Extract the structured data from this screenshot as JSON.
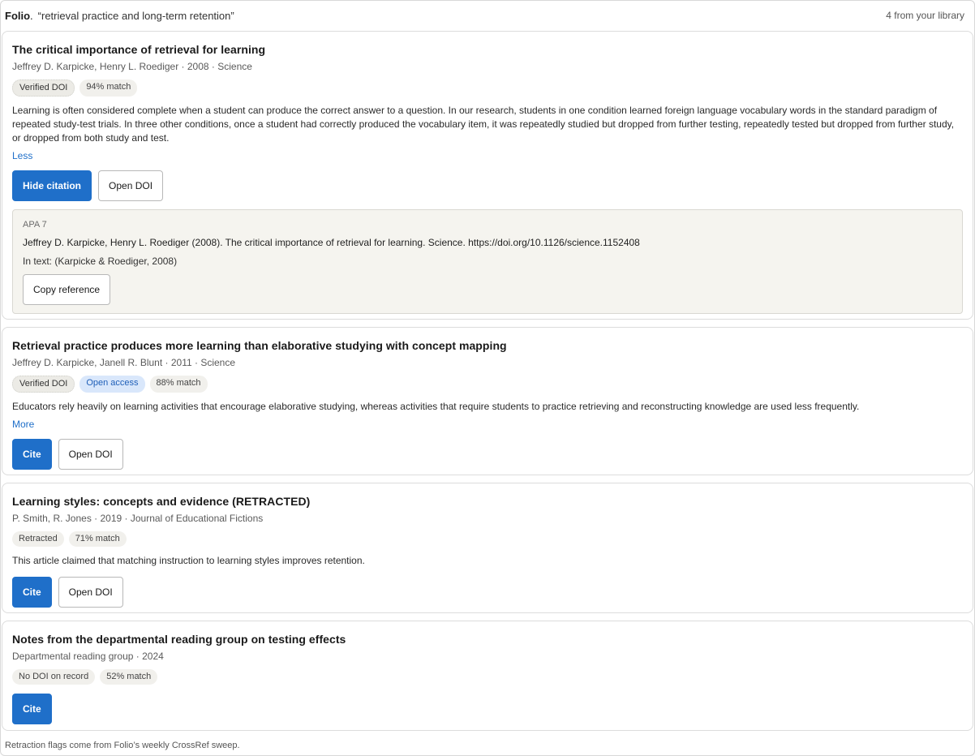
{
  "header": {
    "brand": "Folio",
    "query": "“retrieval practice and long-term retention”",
    "count": "4 from your library"
  },
  "results": [
    {
      "title": "The critical importance of retrieval for learning",
      "meta": "Jeffrey D. Karpicke, Henry L. Roediger · 2008 · Science",
      "badges": [
        "Verified DOI",
        "94% match"
      ],
      "abstract": "Learning is often considered complete when a student can produce the correct answer to a question. In our research, students in one condition learned foreign language vocabulary words in the standard paradigm of repeated study-test trials. In three other conditions, once a student had correctly produced the vocabulary item, it was repeatedly studied but dropped from further testing, repeatedly tested but dropped from further study, or dropped from both study and test.",
      "toggle": "Less",
      "primary_button": "Hide citation",
      "secondary_button": "Open DOI",
      "citation": {
        "style": "APA 7",
        "reference": "Jeffrey D. Karpicke, Henry L. Roediger (2008). The critical importance of retrieval for learning. Science. https://doi.org/10.1126/science.1152408",
        "in_text": "In text: (Karpicke & Roediger, 2008)",
        "copy_button": "Copy reference"
      }
    },
    {
      "title": "Retrieval practice produces more learning than elaborative studying with concept mapping",
      "meta": "Jeffrey D. Karpicke, Janell R. Blunt · 2011 · Science",
      "badges": [
        "Verified DOI",
        "Open access",
        "88% match"
      ],
      "abstract": "Educators rely heavily on learning activities that encourage elaborative studying, whereas activities that require students to practice retrieving and reconstructing knowledge are used less frequently.",
      "toggle": "More",
      "primary_button": "Cite",
      "secondary_button": "Open DOI"
    },
    {
      "title": "Learning styles: concepts and evidence (RETRACTED)",
      "meta": "P. Smith, R. Jones · 2019 · Journal of Educational Fictions",
      "badges": [
        "Retracted",
        "71% match"
      ],
      "abstract": "This article claimed that matching instruction to learning styles improves retention.",
      "primary_button": "Cite",
      "secondary_button": "Open DOI"
    },
    {
      "title": "Notes from the departmental reading group on testing effects",
      "meta": "Departmental reading group · 2024",
      "badges": [
        "No DOI on record",
        "52% match"
      ],
      "primary_button": "Cite"
    }
  ],
  "footer": "Retraction flags come from Folio’s weekly CrossRef sweep.",
  "colors": {
    "accent": "#1f6fc9",
    "open_access_bg": "#d9e7fb",
    "badge_bg": "#f1f0ec",
    "citation_bg": "#f5f4ef"
  }
}
